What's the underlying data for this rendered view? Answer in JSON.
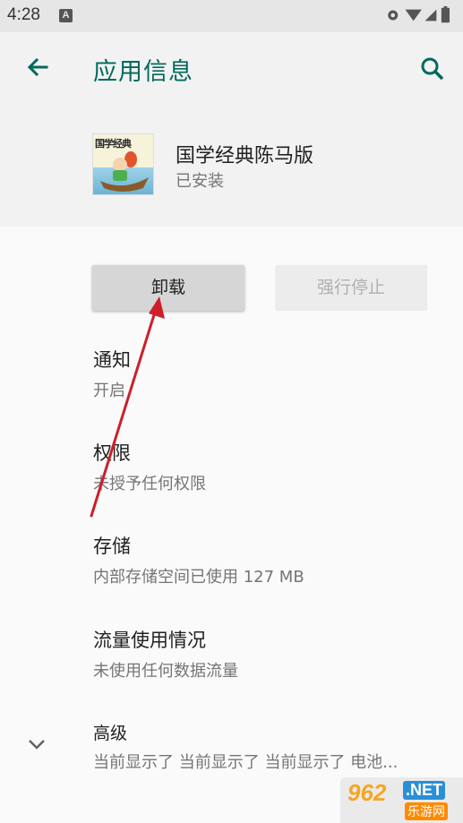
{
  "status_bar": {
    "time": "4:28",
    "notification_letter": "A",
    "icons": [
      "settings-gear-icon",
      "wifi-icon",
      "cellular-signal-icon",
      "battery-icon"
    ]
  },
  "toolbar": {
    "title": "应用信息",
    "back_icon": "arrow-back-icon",
    "search_icon": "search-icon",
    "accent_color": "#00695c"
  },
  "app": {
    "name": "国学经典陈马版",
    "status": "已安装",
    "icon_text": "国学经典"
  },
  "buttons": {
    "uninstall": "卸载",
    "force_stop": "强行停止"
  },
  "items": [
    {
      "title": "通知",
      "subtitle": "开启"
    },
    {
      "title": "权限",
      "subtitle": "未授予任何权限"
    },
    {
      "title": "存储",
      "subtitle": "内部存储空间已使用 127 MB"
    },
    {
      "title": "流量使用情况",
      "subtitle": "未使用任何数据流量"
    },
    {
      "title": "高级",
      "subtitle": "当前显示了 当前显示了 当前显示了 电池..."
    }
  ],
  "watermark": {
    "logo": "962",
    "net": ".NET",
    "sub": "乐游网"
  },
  "annotation_color": "#cc1f2a"
}
